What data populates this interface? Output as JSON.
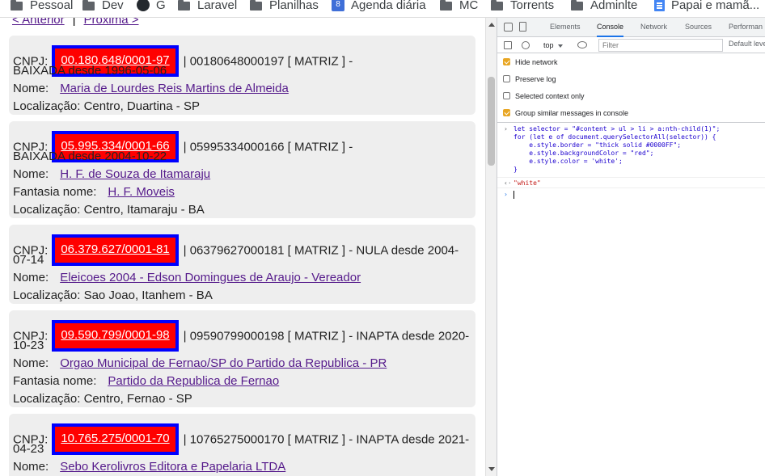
{
  "bookmarks": [
    {
      "label": "Pessoal",
      "icon": "folder-icon"
    },
    {
      "label": "Dev",
      "icon": "folder-icon"
    },
    {
      "label": "G",
      "icon": "github-icon"
    },
    {
      "label": "Laravel",
      "icon": "folder-icon"
    },
    {
      "label": "Planilhas",
      "icon": "folder-icon"
    },
    {
      "label": "Agenda diária",
      "icon": "calendar-icon",
      "icon_text": "8"
    },
    {
      "label": "MC",
      "icon": "folder-icon"
    },
    {
      "label": "Torrents",
      "icon": "folder-icon"
    },
    {
      "label": "Adminlte",
      "icon": "folder-icon"
    },
    {
      "label": "Papai e mamã...",
      "icon": "document-icon"
    }
  ],
  "pager": {
    "prev": "< Anterior",
    "separator": "|",
    "next": "Próxima >"
  },
  "companies": [
    {
      "cnpj_label": "CNPJ:",
      "cnpj": "00.180.648/0001-97",
      "details_1": "| 00180648000197 [ MATRIZ ] -",
      "details_2": "BAIXADA desde 1996-05-06",
      "nome_label": "Nome:",
      "nome": "Maria de Lourdes Reis Martins de Almeida",
      "local_label": "Localização:",
      "local": "Centro, Duartina - SP"
    },
    {
      "cnpj_label": "CNPJ:",
      "cnpj": "05.995.334/0001-66",
      "details_1": "| 05995334000166 [ MATRIZ ] -",
      "details_2": "BAIXADA desde 2004-10-22",
      "nome_label": "Nome:",
      "nome": "H. F. de Souza de Itamaraju",
      "fantasia_label": "Fantasia nome:",
      "fantasia": "H. F. Moveis",
      "local_label": "Localização:",
      "local": "Centro, Itamaraju - BA"
    },
    {
      "cnpj_label": "CNPJ:",
      "cnpj": "06.379.627/0001-81",
      "details_1": "| 06379627000181 [ MATRIZ ] - NULA desde 2004-",
      "details_2": "07-14",
      "nome_label": "Nome:",
      "nome": "Eleicoes 2004 - Edson Domingues de Araujo - Vereador",
      "local_label": "Localização:",
      "local": "Sao Joao, Itanhem - BA"
    },
    {
      "cnpj_label": "CNPJ:",
      "cnpj": "09.590.799/0001-98",
      "details_1": "| 09590799000198 [ MATRIZ ] - INAPTA desde 2020-",
      "details_2": "10-23",
      "nome_label": "Nome:",
      "nome": "Orgao Municipal de Fernao/SP do Partido da Republica - PR",
      "fantasia_label": "Fantasia nome:",
      "fantasia": "Partido da Republica de Fernao",
      "local_label": "Localização:",
      "local": "Centro, Fernao - SP"
    },
    {
      "cnpj_label": "CNPJ:",
      "cnpj": "10.765.275/0001-70",
      "details_1": "| 10765275000170 [ MATRIZ ] - INAPTA desde 2021-",
      "details_2": "04-23",
      "nome_label": "Nome:",
      "nome": "Sebo Kerolivros Editora e Papelaria LTDA"
    }
  ],
  "devtools": {
    "tabs": [
      "Elements",
      "Console",
      "Network",
      "Sources",
      "Performan"
    ],
    "active_tab": "Console",
    "context": "top",
    "filter_placeholder": "Filter",
    "levels": "Default leve",
    "options": [
      {
        "label": "Hide network",
        "checked": true
      },
      {
        "label": "Preserve log",
        "checked": false
      },
      {
        "label": "Selected context only",
        "checked": false
      },
      {
        "label": "Group similar messages in console",
        "checked": true
      }
    ],
    "code_lines": [
      "let selector = \"#content > ul > li > a:nth-child(1)\";",
      "for (let e of document.querySelectorAll(selector)) {",
      "    e.style.border = \"thick solid #0000FF\";",
      "    e.style.backgroundColor = \"red\";",
      "    e.style.color = 'white';",
      "}"
    ],
    "result": "\"white\"",
    "colors": {
      "accent": "#1a73e8",
      "checkbox": "#e8a623"
    }
  },
  "colors": {
    "highlight_bg": "#ff0000",
    "highlight_border": "#0000ff",
    "card_bg": "#eeeeee",
    "link": "#551a8b"
  }
}
